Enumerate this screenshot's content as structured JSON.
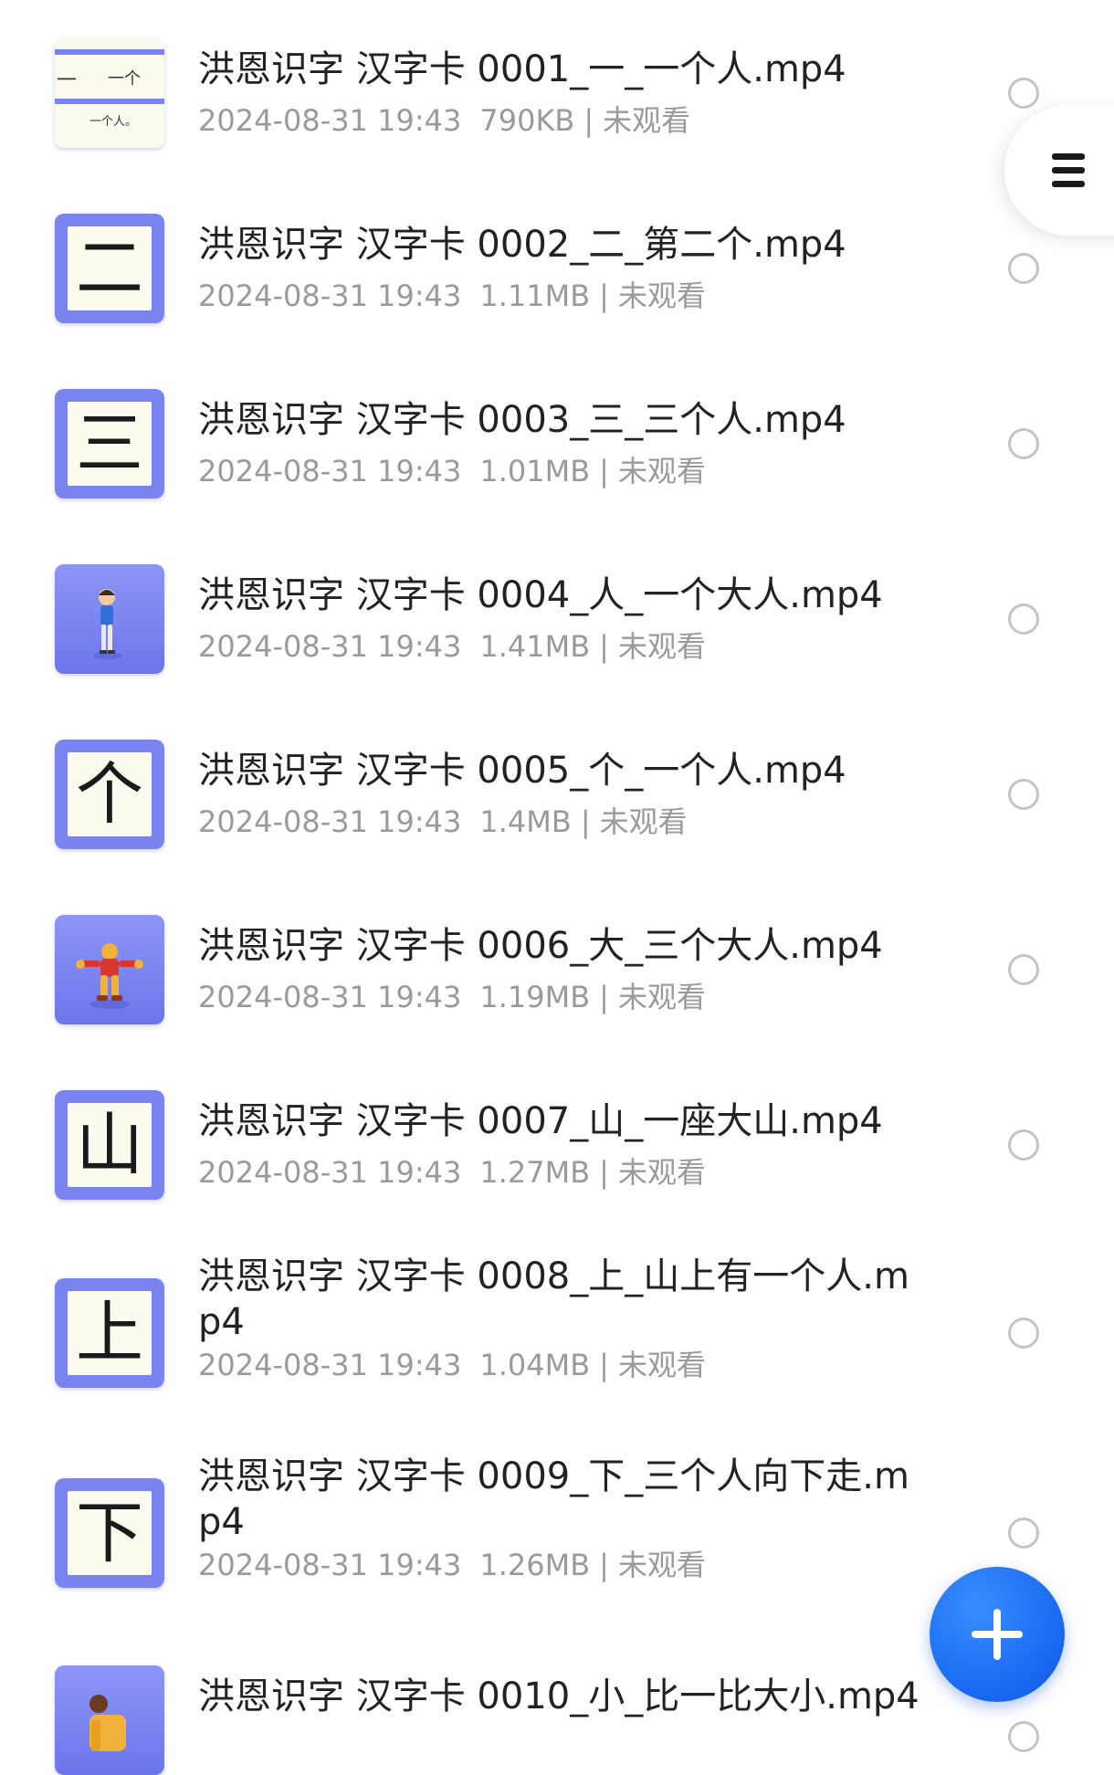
{
  "files": [
    {
      "title": "洪恩识字 汉字卡 0001_一_一个人.mp4",
      "date": "2024-08-31 19:43",
      "size": "790KB",
      "status": "未观看",
      "thumb_char": "",
      "thumb_top_right": "一个",
      "thumb_left": "一",
      "thumb_bottom": "一个人。"
    },
    {
      "title": "洪恩识字 汉字卡 0002_二_第二个.mp4",
      "date": "2024-08-31 19:43",
      "size": "1.11MB",
      "status": "未观看",
      "thumb_char": "二"
    },
    {
      "title": "洪恩识字 汉字卡 0003_三_三个人.mp4",
      "date": "2024-08-31 19:43",
      "size": "1.01MB",
      "status": "未观看",
      "thumb_char": "三"
    },
    {
      "title": "洪恩识字 汉字卡 0004_人_一个大人.mp4",
      "date": "2024-08-31 19:43",
      "size": "1.41MB",
      "status": "未观看",
      "thumb_char": ""
    },
    {
      "title": "洪恩识字 汉字卡 0005_个_一个人.mp4",
      "date": "2024-08-31 19:43",
      "size": "1.4MB",
      "status": "未观看",
      "thumb_char": "个"
    },
    {
      "title": "洪恩识字 汉字卡 0006_大_三个大人.mp4",
      "date": "2024-08-31 19:43",
      "size": "1.19MB",
      "status": "未观看",
      "thumb_char": ""
    },
    {
      "title": "洪恩识字 汉字卡 0007_山_一座大山.mp4",
      "date": "2024-08-31 19:43",
      "size": "1.27MB",
      "status": "未观看",
      "thumb_char": "山"
    },
    {
      "title": "洪恩识字 汉字卡 0008_上_山上有一个人.mp4",
      "date": "2024-08-31 19:43",
      "size": "1.04MB",
      "status": "未观看",
      "thumb_char": "上"
    },
    {
      "title": "洪恩识字 汉字卡 0009_下_三个人向下走.mp4",
      "date": "2024-08-31 19:43",
      "size": "1.26MB",
      "status": "未观看",
      "thumb_char": "下"
    },
    {
      "title": "洪恩识字 汉字卡 0010_小_比一比大小.mp4",
      "date": "",
      "size": "",
      "status": "",
      "thumb_char": ""
    }
  ],
  "meta_separator": "|",
  "icons": {
    "menu": "menu-icon",
    "fab": "plus-icon"
  },
  "colors": {
    "accent": "#1867f0",
    "thumb_frame": "#7a84f0",
    "title_text": "#222222",
    "meta_text": "#9a9a9a"
  }
}
